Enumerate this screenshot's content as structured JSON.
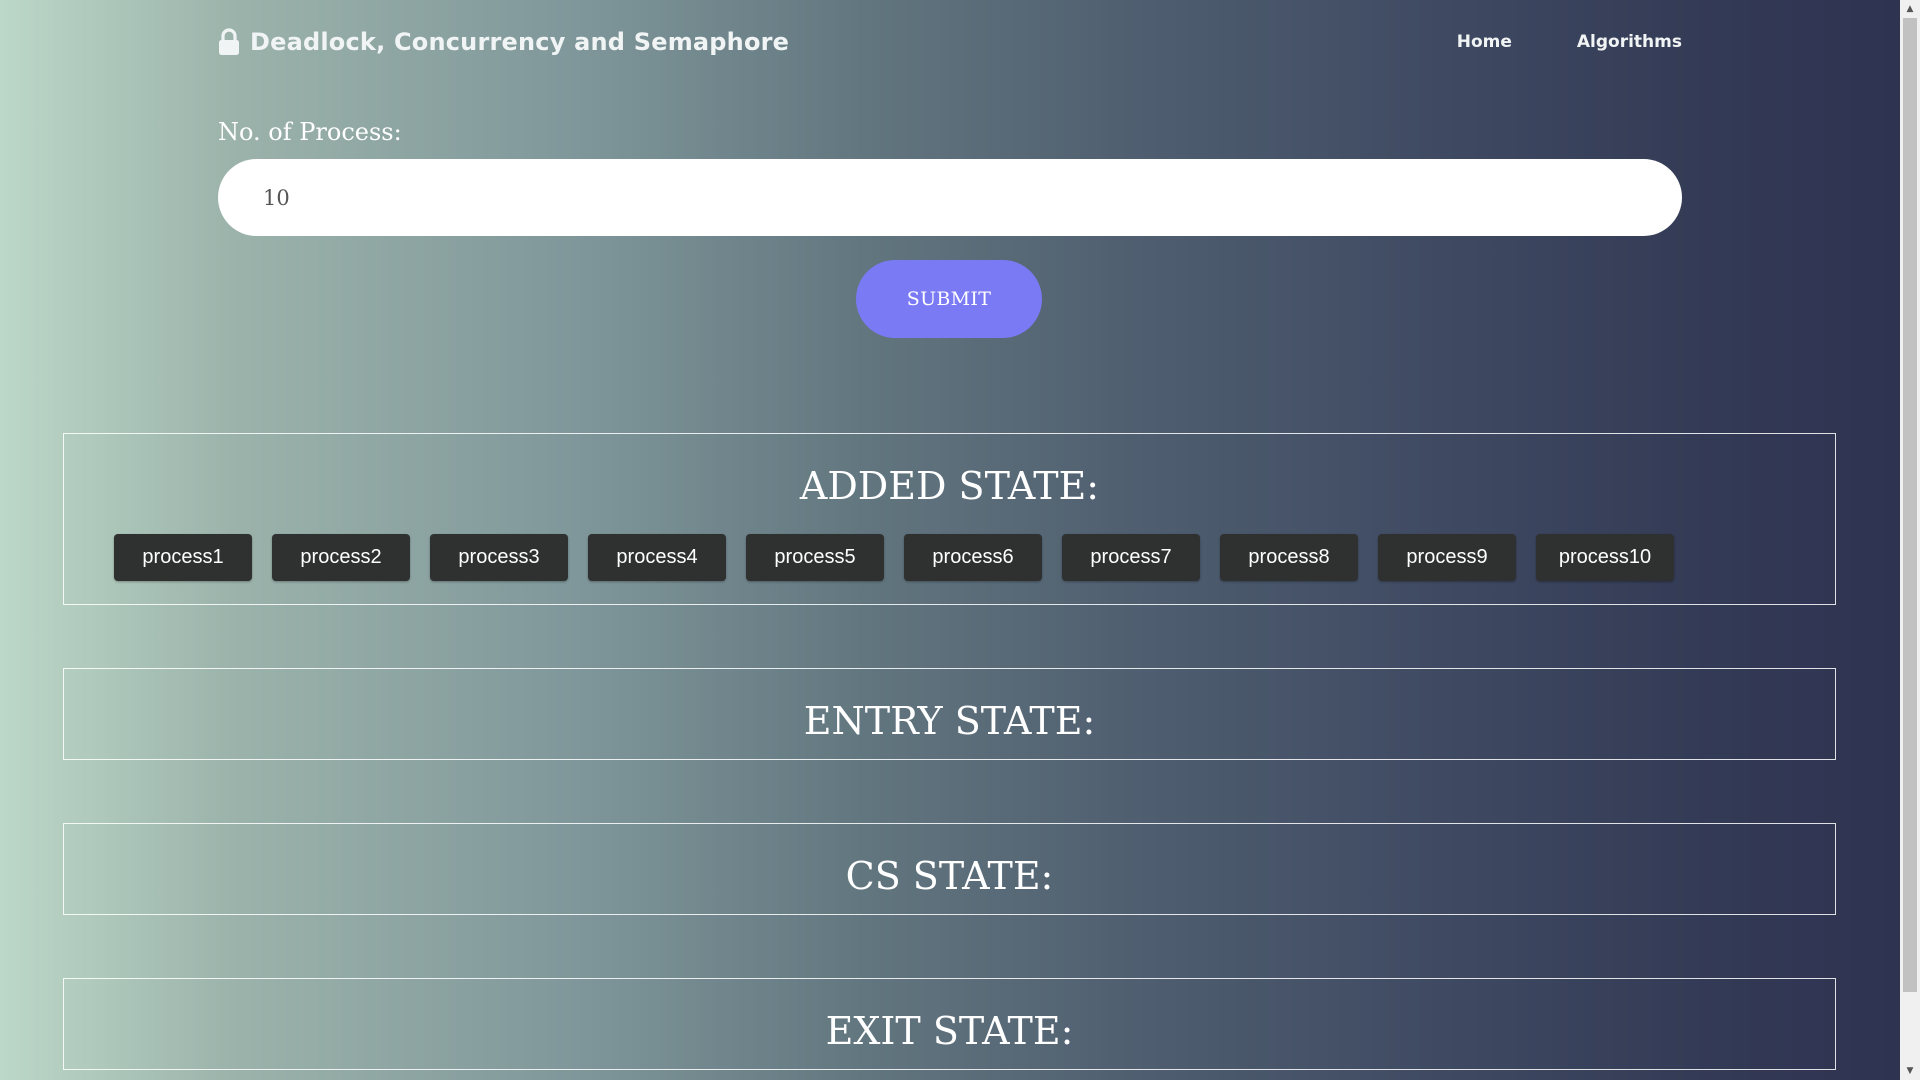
{
  "header": {
    "brand_icon": "lock-icon",
    "brand_title": "Deadlock, Concurrency and Semaphore",
    "nav": [
      {
        "label": "Home"
      },
      {
        "label": "Algorithms"
      }
    ]
  },
  "form": {
    "label": "No. of Process:",
    "input_value": "10",
    "submit_label": "SUBMIT"
  },
  "panels": {
    "added": {
      "title": "ADDED STATE:",
      "processes": [
        "process1",
        "process2",
        "process3",
        "process4",
        "process5",
        "process6",
        "process7",
        "process8",
        "process9",
        "process10"
      ]
    },
    "entry": {
      "title": "ENTRY STATE:"
    },
    "cs": {
      "title": "CS STATE:"
    },
    "exit": {
      "title": "EXIT STATE:"
    }
  },
  "colors": {
    "submit_button": "#7b7af5",
    "process_chip": "#2f3030",
    "gradient_start": "#bcd8c8",
    "gradient_end": "#2d3250"
  }
}
